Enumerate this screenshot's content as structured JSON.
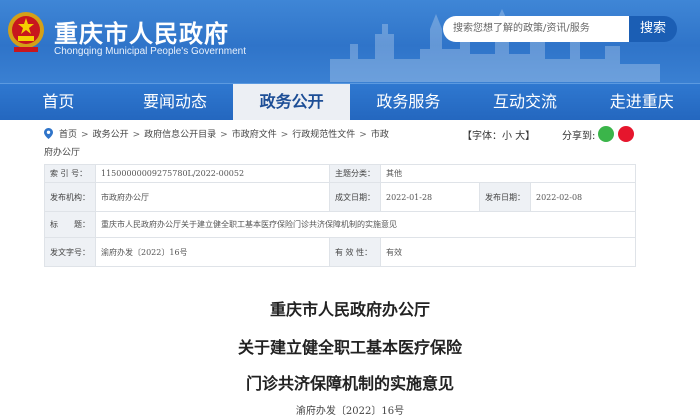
{
  "header": {
    "title": "重庆市人民政府",
    "subtitle": "Chongqing Municipal People's Government",
    "search_placeholder": "搜索您想了解的政策/资讯/服务",
    "search_button": "搜索"
  },
  "nav": {
    "items": [
      "首页",
      "要闻动态",
      "政务公开",
      "政务服务",
      "互动交流",
      "走进重庆"
    ],
    "active_index": 2
  },
  "breadcrumb": {
    "items": [
      "首页",
      "政务公开",
      "政府信息公开目录",
      "市政府文件",
      "行政规范性文件",
      "市政府办公厅"
    ]
  },
  "font_control": "【字体：小 大】",
  "share_label": "分享到:",
  "meta": {
    "index_no_label": "索 引 号：",
    "index_no": "11500000009275780L/2022-00052",
    "theme_label": "主题分类：",
    "theme": "其他",
    "issuer_label": "发布机构：",
    "issuer": "市政府办公厅",
    "created_label": "成文日期：",
    "created": "2022-01-28",
    "published_label": "发布日期：",
    "published": "2022-02-08",
    "title_label": "标　　题：",
    "title": "重庆市人民政府办公厅关于建立健全职工基本医疗保险门诊共济保障机制的实施意见",
    "doc_no_label": "发文字号：",
    "doc_no": "渝府办发〔2022〕16号",
    "validity_label": "有 效 性：",
    "validity": "有效"
  },
  "document": {
    "line1": "重庆市人民政府办公厅",
    "line2": "关于建立健全职工基本医疗保险",
    "line3": "门诊共济保障机制的实施意见",
    "number": "渝府办发〔2022〕16号"
  },
  "colors": {
    "header_blue": "#3f86d6",
    "nav_blue": "#2467bf",
    "active_tab_bg": "#eceff4",
    "search_button": "#1b5eb4"
  }
}
